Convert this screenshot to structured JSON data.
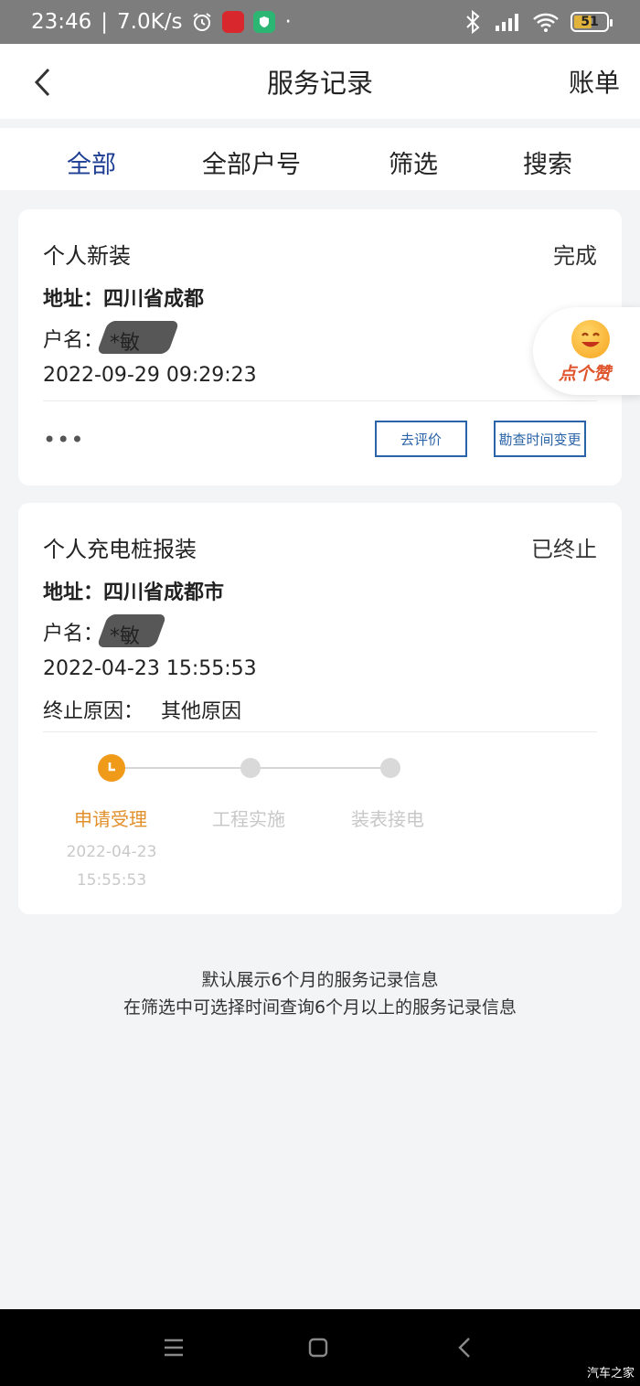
{
  "status_bar": {
    "time": "23:46",
    "speed": "7.0K/s",
    "battery": "51"
  },
  "header": {
    "title": "服务记录",
    "right_link": "账单"
  },
  "tabs": [
    {
      "label": "全部",
      "active": true
    },
    {
      "label": "全部户号",
      "active": false
    },
    {
      "label": "筛选",
      "active": false
    },
    {
      "label": "搜索",
      "active": false
    }
  ],
  "records": [
    {
      "type": "个人新装",
      "status": "完成",
      "address": "地址：四川省成都",
      "account_label": "户名：",
      "account_name": "*敏",
      "datetime": "2022-09-29 09:29:23",
      "more": "•••",
      "actions": [
        "去评价",
        "勘查时间变更"
      ]
    },
    {
      "type": "个人充电桩报装",
      "status": "已终止",
      "address": "地址：四川省成都市",
      "account_label": "户名：",
      "account_name": "*敏",
      "datetime": "2022-04-23 15:55:53",
      "reason_label": "终止原因：",
      "reason": "其他原因",
      "progress": [
        {
          "label": "申请受理",
          "date": "2022-04-23",
          "time": "15:55:53",
          "active": true
        },
        {
          "label": "工程实施",
          "active": false
        },
        {
          "label": "装表接电",
          "active": false
        }
      ]
    }
  ],
  "like_button": {
    "label": "点个赞"
  },
  "footer_note": {
    "line1": "默认展示6个月的服务记录信息",
    "line2": "在筛选中可选择时间查询6个月以上的服务记录信息"
  },
  "watermark": "汽车之家",
  "colors": {
    "accent": "#1f3f94",
    "button_outline": "#2a63a7",
    "progress_active": "#f09a1a"
  }
}
